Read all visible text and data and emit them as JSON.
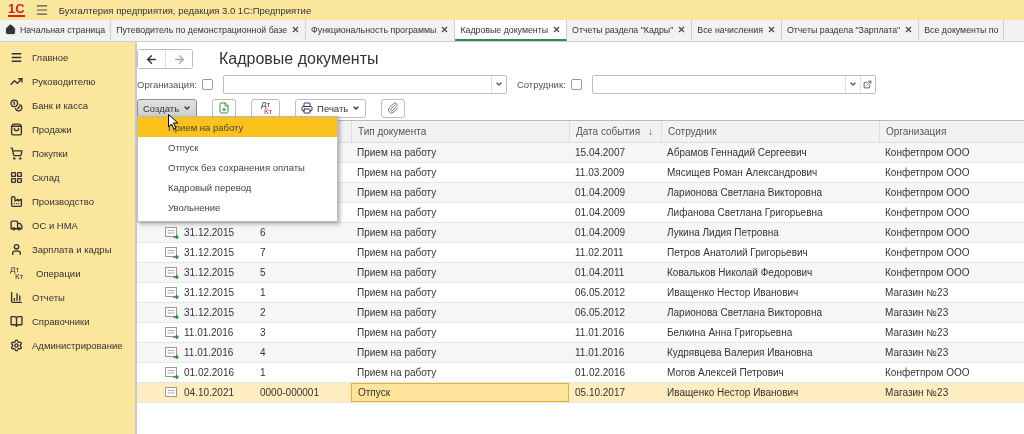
{
  "window": {
    "logo": "1С",
    "title": "Бухгалтерия предприятия, редакция 3.0 1С:Предприятие"
  },
  "tabs": [
    {
      "label": "Начальная страница",
      "kind": "home",
      "selected": false,
      "closable": false
    },
    {
      "label": "Путеводитель по демонстрационной базе",
      "kind": "page",
      "selected": false,
      "closable": true
    },
    {
      "label": "Функциональность программы",
      "kind": "page",
      "selected": false,
      "closable": true
    },
    {
      "label": "Кадровые документы",
      "kind": "page",
      "selected": true,
      "closable": true
    },
    {
      "label": "Отчеты раздела \"Кадры\"",
      "kind": "page",
      "selected": false,
      "closable": true
    },
    {
      "label": "Все начисления",
      "kind": "page",
      "selected": false,
      "closable": true
    },
    {
      "label": "Отчеты раздела \"Зарплата\"",
      "kind": "page",
      "selected": false,
      "closable": true
    },
    {
      "label": "Все документы по",
      "kind": "page",
      "selected": false,
      "closable": false
    }
  ],
  "sidebar": {
    "items": [
      {
        "label": "Главное"
      },
      {
        "label": "Руководителю"
      },
      {
        "label": "Банк и касса"
      },
      {
        "label": "Продажи"
      },
      {
        "label": "Покупки"
      },
      {
        "label": "Склад"
      },
      {
        "label": "Производство"
      },
      {
        "label": "ОС и НМА"
      },
      {
        "label": "Зарплата и кадры"
      },
      {
        "label": "Операции",
        "glyph": [
          "Дт",
          "Кт"
        ]
      },
      {
        "label": "Отчеты"
      },
      {
        "label": "Справочники"
      },
      {
        "label": "Администрирование"
      }
    ]
  },
  "form": {
    "title": "Кадровые документы",
    "filters": [
      {
        "label": "Организация:",
        "checked": false,
        "open_button": false
      },
      {
        "label": "Сотрудник:",
        "checked": false,
        "open_button": true
      }
    ],
    "toolbar": [
      {
        "kind": "create",
        "label": "Создать",
        "pressed": true
      },
      {
        "kind": "new-doc",
        "pressed": false
      },
      {
        "kind": "dtkt",
        "glyph": [
          "Дт",
          "Кт"
        ],
        "pressed": false
      },
      {
        "kind": "print",
        "label": "Печать",
        "pressed": false
      },
      {
        "kind": "attach",
        "pressed": false
      }
    ],
    "create_menu": [
      {
        "label": "Прием на работу",
        "selected": true
      },
      {
        "label": "Отпуск",
        "selected": false
      },
      {
        "label": "Отпуск без сохранения оплаты",
        "selected": false
      },
      {
        "label": "Кадровый перевод",
        "selected": false
      },
      {
        "label": "Увольнение",
        "selected": false
      }
    ]
  },
  "table": {
    "columns": [
      {
        "label": "Тип документа"
      },
      {
        "label": "Дата события",
        "sort_mark": "↓"
      },
      {
        "label": "Сотрудник"
      },
      {
        "label": "Организация"
      }
    ],
    "rows": [
      {
        "type": "Прием на работу",
        "event_date": "15.04.2007",
        "employee": "Абрамов Геннадий Сергеевич",
        "organization": "Конфетпром ООО",
        "selected": false
      },
      {
        "type": "Прием на работу",
        "event_date": "11.03.2009",
        "employee": "Мясищев Роман Александрович",
        "organization": "Конфетпром ООО",
        "selected": false
      },
      {
        "type": "Прием на работу",
        "event_date": "01.04.2009",
        "employee": "Ларионова Светлана Викторовна",
        "organization": "Конфетпром ООО",
        "selected": false
      },
      {
        "type": "Прием на работу",
        "event_date": "01.04.2009",
        "employee": "Лифанова Светлана Григорьевна",
        "organization": "Конфетпром ООО",
        "selected": false
      },
      {
        "posted": true,
        "date": "31.12.2015",
        "number": "6",
        "type": "Прием на работу",
        "event_date": "01.04.2009",
        "employee": "Лукина Лидия Петровна",
        "organization": "Конфетпром ООО",
        "selected": false
      },
      {
        "posted": true,
        "date": "31.12.2015",
        "number": "7",
        "type": "Прием на работу",
        "event_date": "11.02.2011",
        "employee": "Петров Анатолий Григорьевич",
        "organization": "Конфетпром ООО",
        "selected": false
      },
      {
        "posted": true,
        "date": "31.12.2015",
        "number": "5",
        "type": "Прием на работу",
        "event_date": "01.04.2011",
        "employee": "Ковальков Николай Федорович",
        "organization": "Конфетпром ООО",
        "selected": false
      },
      {
        "posted": true,
        "date": "31.12.2015",
        "number": "1",
        "type": "Прием на работу",
        "event_date": "06.05.2012",
        "employee": "Иващенко Нестор Иванович",
        "organization": "Магазин №23",
        "selected": false
      },
      {
        "posted": true,
        "date": "31.12.2015",
        "number": "2",
        "type": "Прием на работу",
        "event_date": "06.05.2012",
        "employee": "Ларионова Светлана Викторовна",
        "organization": "Магазин №23",
        "selected": false
      },
      {
        "posted": true,
        "date": "11.01.2016",
        "number": "3",
        "type": "Прием на работу",
        "event_date": "11.01.2016",
        "employee": "Белкина Анна Григорьевна",
        "organization": "Магазин №23",
        "selected": false
      },
      {
        "posted": true,
        "date": "11.01.2016",
        "number": "4",
        "type": "Прием на работу",
        "event_date": "11.01.2016",
        "employee": "Кудрявцева Валерия Ивановна",
        "organization": "Магазин №23",
        "selected": false
      },
      {
        "posted": true,
        "date": "01.02.2016",
        "number": "1",
        "type": "Прием на работу",
        "event_date": "01.02.2016",
        "employee": "Могов Алексей Петрович",
        "organization": "Конфетпром ООО",
        "selected": false
      },
      {
        "posted": false,
        "date": "04.10.2021",
        "number": "0000-000001",
        "type": "Отпуск",
        "event_date": "05.10.2017",
        "employee": "Иващенко Нестор Иванович",
        "organization": "Магазин №23",
        "selected": true
      }
    ]
  }
}
